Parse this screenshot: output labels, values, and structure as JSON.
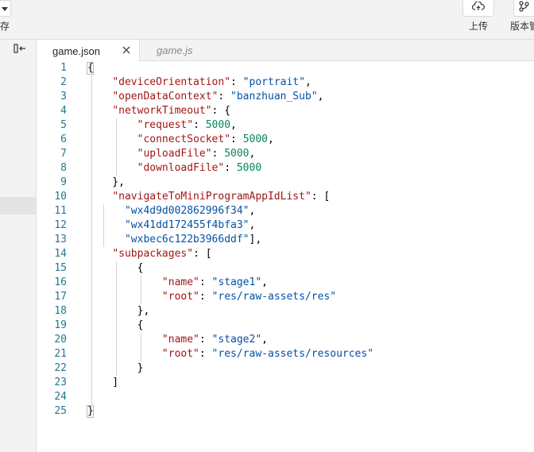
{
  "toolbar": {
    "left_label": "存",
    "upload_label": "上传",
    "version_label": "版本管",
    "upload_icon": "cloud-upload-icon",
    "version_icon": "branch-icon"
  },
  "sidebar": {
    "toggle_icon": "sidebar-collapse-icon"
  },
  "tabs": [
    {
      "label": "game.json",
      "active": true
    },
    {
      "label": "game.js",
      "active": false
    }
  ],
  "editor": {
    "lines": [
      [
        [
          "p",
          "{"
        ]
      ],
      [
        [
          "p",
          "    "
        ],
        [
          "k",
          "\"deviceOrientation\""
        ],
        [
          "p",
          ": "
        ],
        [
          "s",
          "\"portrait\""
        ],
        [
          "p",
          ","
        ]
      ],
      [
        [
          "p",
          "    "
        ],
        [
          "k",
          "\"openDataContext\""
        ],
        [
          "p",
          ": "
        ],
        [
          "s",
          "\"banzhuan_Sub\""
        ],
        [
          "p",
          ","
        ]
      ],
      [
        [
          "p",
          "    "
        ],
        [
          "k",
          "\"networkTimeout\""
        ],
        [
          "p",
          ": {"
        ]
      ],
      [
        [
          "p",
          "        "
        ],
        [
          "k",
          "\"request\""
        ],
        [
          "p",
          ": "
        ],
        [
          "n",
          "5000"
        ],
        [
          "p",
          ","
        ]
      ],
      [
        [
          "p",
          "        "
        ],
        [
          "k",
          "\"connectSocket\""
        ],
        [
          "p",
          ": "
        ],
        [
          "n",
          "5000"
        ],
        [
          "p",
          ","
        ]
      ],
      [
        [
          "p",
          "        "
        ],
        [
          "k",
          "\"uploadFile\""
        ],
        [
          "p",
          ": "
        ],
        [
          "n",
          "5000"
        ],
        [
          "p",
          ","
        ]
      ],
      [
        [
          "p",
          "        "
        ],
        [
          "k",
          "\"downloadFile\""
        ],
        [
          "p",
          ": "
        ],
        [
          "n",
          "5000"
        ]
      ],
      [
        [
          "p",
          "    },"
        ]
      ],
      [
        [
          "p",
          "    "
        ],
        [
          "k",
          "\"navigateToMiniProgramAppIdList\""
        ],
        [
          "p",
          ": ["
        ]
      ],
      [
        [
          "p",
          "      "
        ],
        [
          "s",
          "\"wx4d9d002862996f34\""
        ],
        [
          "p",
          ","
        ]
      ],
      [
        [
          "p",
          "      "
        ],
        [
          "s",
          "\"wx41dd172455f4bfa3\""
        ],
        [
          "p",
          ","
        ]
      ],
      [
        [
          "p",
          "      "
        ],
        [
          "s",
          "\"wxbec6c122b3966ddf\""
        ],
        [
          "p",
          "],"
        ]
      ],
      [
        [
          "p",
          "    "
        ],
        [
          "k",
          "\"subpackages\""
        ],
        [
          "p",
          ": ["
        ]
      ],
      [
        [
          "p",
          "        {"
        ]
      ],
      [
        [
          "p",
          "            "
        ],
        [
          "k",
          "\"name\""
        ],
        [
          "p",
          ": "
        ],
        [
          "s",
          "\"stage1\""
        ],
        [
          "p",
          ","
        ]
      ],
      [
        [
          "p",
          "            "
        ],
        [
          "k",
          "\"root\""
        ],
        [
          "p",
          ": "
        ],
        [
          "s",
          "\"res/raw-assets/res\""
        ]
      ],
      [
        [
          "p",
          "        },"
        ]
      ],
      [
        [
          "p",
          "        {"
        ]
      ],
      [
        [
          "p",
          "            "
        ],
        [
          "k",
          "\"name\""
        ],
        [
          "p",
          ": "
        ],
        [
          "s",
          "\"stage2\""
        ],
        [
          "p",
          ","
        ]
      ],
      [
        [
          "p",
          "            "
        ],
        [
          "k",
          "\"root\""
        ],
        [
          "p",
          ": "
        ],
        [
          "s",
          "\"res/raw-assets/resources\""
        ]
      ],
      [
        [
          "p",
          "        }"
        ]
      ],
      [
        [
          "p",
          "    ]"
        ]
      ],
      [
        [
          "p",
          ""
        ]
      ],
      [
        [
          "p",
          "}"
        ]
      ]
    ]
  },
  "colors": {
    "key": "#a31515",
    "string": "#0451a5",
    "number": "#098658",
    "line_number": "#237893"
  }
}
